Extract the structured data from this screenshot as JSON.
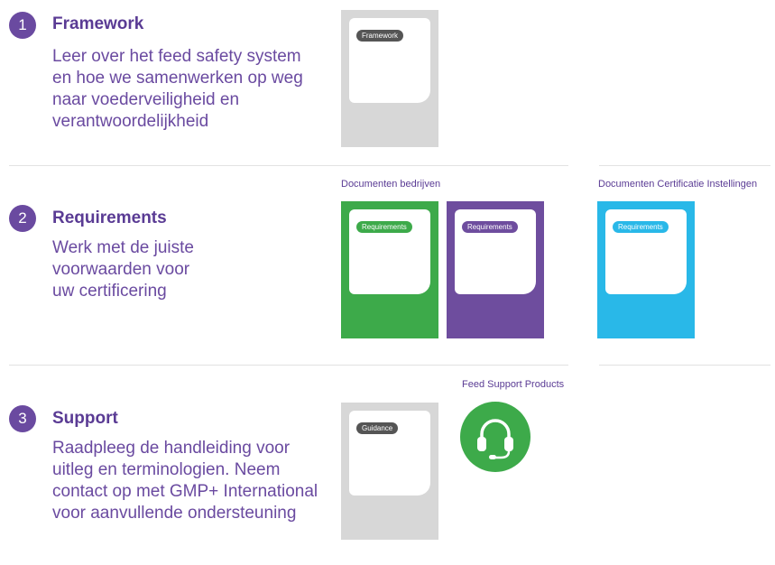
{
  "steps": [
    {
      "number": "1",
      "title": "Framework",
      "description": "Leer over het feed safety system\nen hoe we samenwerken op weg\nnaar voederveiligheid en\nverantwoordelijkheid"
    },
    {
      "number": "2",
      "title": "Requirements",
      "description": "Werk met de juiste\nvoorwaarden voor\nuw certificering"
    },
    {
      "number": "3",
      "title": "Support",
      "description": "Raadpleeg de handleiding voor\nuitleg en terminologien. Neem\ncontact op met GMP+ International\nvoor aanvullende ondersteuning"
    }
  ],
  "labels": {
    "companies": "Documenten bedrijven",
    "certification": "Documenten Certificatie Instellingen",
    "support_products": "Feed Support Products"
  },
  "docs": {
    "framework": "Framework",
    "req_green": "Requirements",
    "req_purple": "Requirements",
    "req_cyan": "Requirements",
    "guidance": "Guidance"
  },
  "colors": {
    "purple": "#6a4aa0",
    "green": "#3daa4a",
    "cyan": "#29b8e8",
    "gray": "#d7d7d7"
  },
  "icons": {
    "support": "headset-icon"
  }
}
